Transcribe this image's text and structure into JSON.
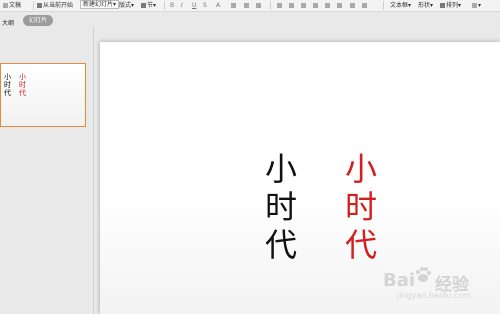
{
  "ribbon": {
    "items": [
      {
        "label": "文稿",
        "icon": "slide-icon"
      },
      {
        "label": "从当前开始",
        "icon": "play-from-current-icon"
      },
      {
        "label": "新建幻灯片",
        "icon": "new-slide-icon"
      },
      {
        "label": "版式",
        "icon": "layout-icon"
      },
      {
        "label": "节",
        "icon": "section-icon"
      },
      {
        "label": "文本框",
        "icon": "textbox-icon"
      },
      {
        "label": "形状",
        "icon": "shape-icon"
      },
      {
        "label": "排列",
        "icon": "arrange-icon"
      }
    ]
  },
  "tabs": {
    "outline": "大纲",
    "slides": "幻灯片"
  },
  "slide": {
    "col1": [
      "小",
      "时",
      "代"
    ],
    "col2": [
      "小",
      "时",
      "代"
    ],
    "col1_color": "#111111",
    "col2_color": "#d21f1f"
  },
  "thumb": {
    "col1": [
      "小",
      "时",
      "代"
    ],
    "col2": [
      "小",
      "时",
      "代"
    ]
  },
  "watermark": {
    "brand": "Bai",
    "brand_cn": "经验",
    "url": "jingyan.baidu.com"
  },
  "colors": {
    "accent_orange": "#e58a3a",
    "tab_active": "#9c9c9c"
  }
}
